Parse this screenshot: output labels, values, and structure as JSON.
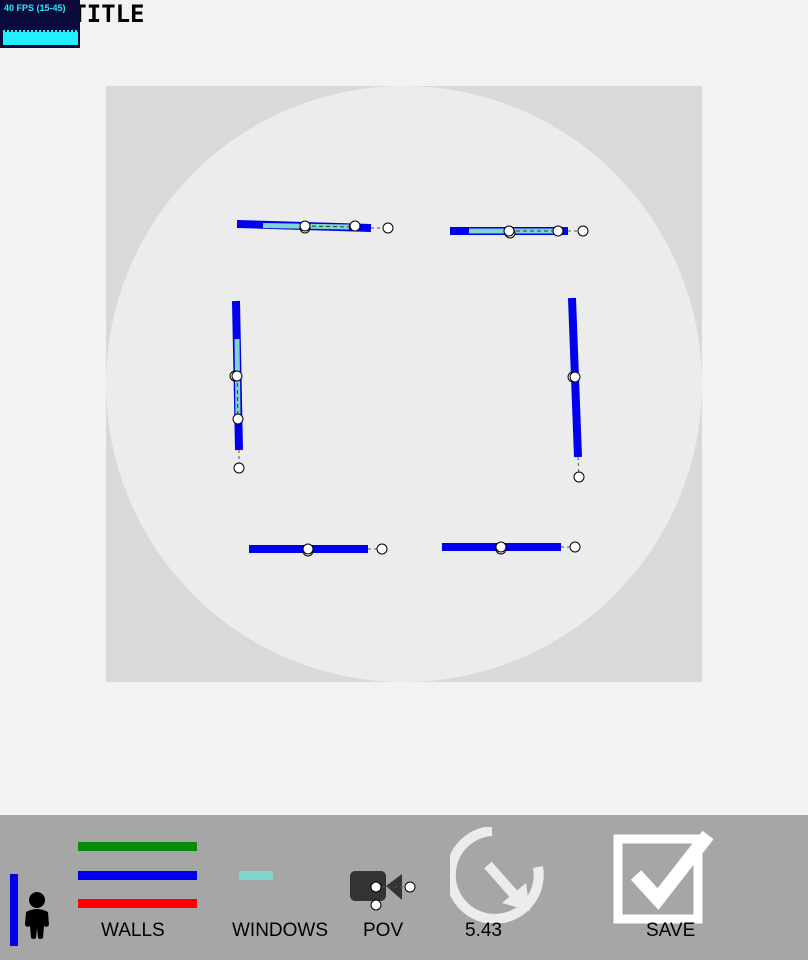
{
  "page": {
    "title": "TEST TITLE",
    "fps_label": "40 FPS (15-45)"
  },
  "colors": {
    "background": "#f2f2f2",
    "canvas_bg": "#d9d9d9",
    "circle": "#ececec",
    "wall": "#0000ee",
    "window": "#7fd6cc",
    "toolbar": "#a6a6a6",
    "wall_green": "#0a8a0a",
    "wall_red": "#ff0000"
  },
  "toolbar": {
    "person_icon": "person-icon",
    "walls_label": "WALLS",
    "windows_label": "WINDOWS",
    "pov_label": "POV",
    "rotation_value": "5.43",
    "save_label": "SAVE"
  }
}
